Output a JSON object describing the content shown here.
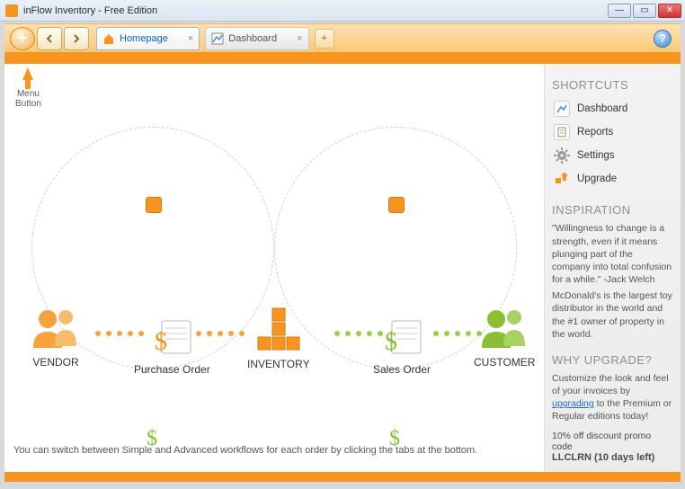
{
  "window": {
    "title": "inFlow Inventory - Free Edition"
  },
  "hint": {
    "label1": "Menu",
    "label2": "Button"
  },
  "tabs": [
    {
      "label": "Homepage",
      "active": true
    },
    {
      "label": "Dashboard",
      "active": false
    }
  ],
  "workflow": {
    "vendor": "VENDOR",
    "po": "Purchase Order",
    "inventory": "INVENTORY",
    "so": "Sales Order",
    "customer": "CUSTOMER"
  },
  "footer_hint": "You can switch between Simple and Advanced workflows for each order by clicking the tabs at the bottom.",
  "sidebar": {
    "shortcuts_title": "SHORTCUTS",
    "items": [
      {
        "label": "Dashboard"
      },
      {
        "label": "Reports"
      },
      {
        "label": "Settings"
      },
      {
        "label": "Upgrade"
      }
    ],
    "inspiration_title": "INSPIRATION",
    "inspiration1": "\"Willingness to change is a strength, even if it means plunging part of the company into total confusion for a while.\" -Jack Welch",
    "inspiration2": "McDonald's is the largest toy distributor in the world and the #1 owner of property in the world.",
    "why_title": "WHY UPGRADE?",
    "why_text_pre": "Customize the look and feel of your invoices by ",
    "why_link": "upgrading",
    "why_text_post": " to the Premium or Regular editions today!",
    "promo_line": "10% off discount promo code",
    "promo_code": "LLCLRN  (10 days left)"
  }
}
